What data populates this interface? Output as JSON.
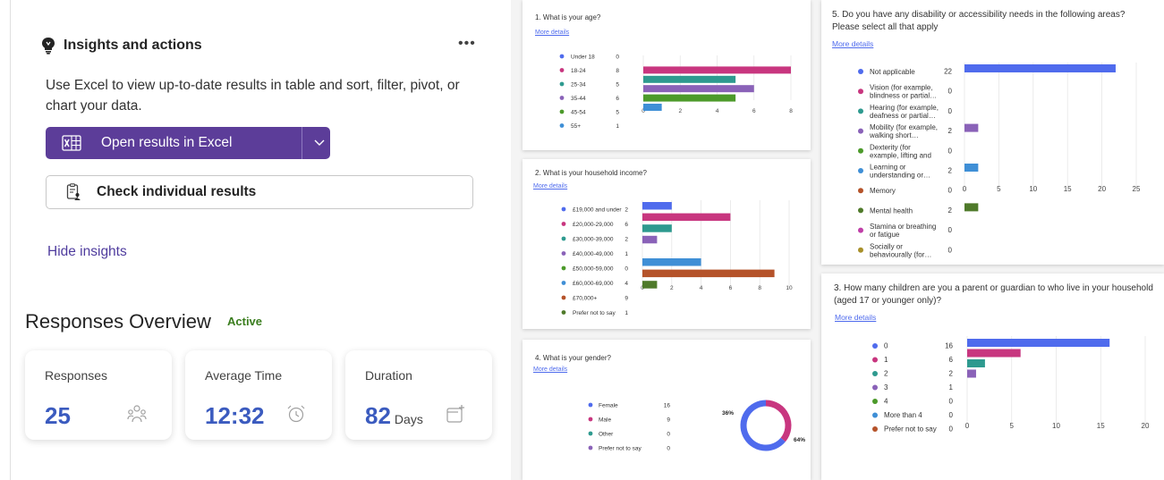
{
  "insights": {
    "title": "Insights and actions",
    "more": "•••",
    "description": "Use Excel to view up-to-date results in table and sort, filter, pivot, or chart your data.",
    "excel_button": "Open results in Excel",
    "check_button": "Check individual results",
    "hide_link": "Hide insights"
  },
  "overview": {
    "title": "Responses Overview",
    "status": "Active",
    "cards": [
      {
        "title": "Responses",
        "value": "25",
        "unit": ""
      },
      {
        "title": "Average Time",
        "value": "12:32",
        "unit": ""
      },
      {
        "title": "Duration",
        "value": "82",
        "unit": "Days"
      }
    ]
  },
  "more_details": "More details",
  "colors": {
    "purple": "#5c3d99",
    "blue": "#3b5bbf",
    "green": "#3a7d1e"
  },
  "chart_data": [
    {
      "type": "bar",
      "title": "1. What is your age?",
      "categories": [
        "Under 18",
        "18-24",
        "25-34",
        "35-44",
        "45-54",
        "55+"
      ],
      "values": [
        0,
        8,
        5,
        6,
        5,
        1
      ],
      "colors": [
        "#4f6bed",
        "#c8367f",
        "#2e9a8f",
        "#8a62b8",
        "#4c9a2a",
        "#3f8fd6"
      ],
      "xlim": [
        0,
        8
      ],
      "ticks": [
        0,
        2,
        4,
        6,
        8
      ]
    },
    {
      "type": "bar",
      "title": "2. What is your household income?",
      "categories": [
        "£19,000 and under",
        "£20,000-29,000",
        "£30,000-39,000",
        "£40,000-49,000",
        "£50,000-59,000",
        "£60,000-69,000",
        "£70,000+",
        "Prefer not to say"
      ],
      "values": [
        2,
        6,
        2,
        1,
        0,
        4,
        9,
        1
      ],
      "colors": [
        "#4f6bed",
        "#c8367f",
        "#2e9a8f",
        "#8a62b8",
        "#4c9a2a",
        "#3f8fd6",
        "#b5532a",
        "#4f7a2a"
      ],
      "xlim": [
        0,
        10
      ],
      "ticks": [
        0,
        2,
        4,
        6,
        8,
        10
      ]
    },
    {
      "type": "pie",
      "title": "4. What is your gender?",
      "categories": [
        "Female",
        "Male",
        "Other",
        "Prefer not to say"
      ],
      "values": [
        16,
        9,
        0,
        0
      ],
      "colors": [
        "#4f6bed",
        "#c8367f",
        "#2e9a8f",
        "#8a62b8"
      ],
      "labels": [
        "64%",
        "36%"
      ]
    },
    {
      "type": "bar",
      "title": "5. Do you have any disability or accessibility needs in the following areas? Please select all that apply",
      "categories": [
        "Not applicable",
        "Vision (for example, blindness or partial…",
        "Hearing (for example, deafness or partial…",
        "Mobility (for example, walking short…",
        "Dexterity (for example, lifting and carrying…",
        "Learning or understanding or…",
        "Memory",
        "Mental health",
        "Stamina or breathing or fatigue",
        "Socially or behaviourally (for…"
      ],
      "values": [
        22,
        0,
        0,
        2,
        0,
        2,
        0,
        2,
        0,
        0
      ],
      "colors": [
        "#4f6bed",
        "#c8367f",
        "#2e9a8f",
        "#8a62b8",
        "#4c9a2a",
        "#3f8fd6",
        "#b5532a",
        "#4f7a2a",
        "#c03fa8",
        "#a8902a"
      ],
      "xlim": [
        0,
        25
      ],
      "ticks": [
        0,
        5,
        10,
        15,
        20,
        25
      ]
    },
    {
      "type": "bar",
      "title": "3. How many children are you a parent or guardian to who live in your household (aged 17 or younger only)?",
      "categories": [
        "0",
        "1",
        "2",
        "3",
        "4",
        "More than 4",
        "Prefer not to say"
      ],
      "values": [
        16,
        6,
        2,
        1,
        0,
        0,
        0
      ],
      "colors": [
        "#4f6bed",
        "#c8367f",
        "#2e9a8f",
        "#8a62b8",
        "#4c9a2a",
        "#3f8fd6",
        "#b5532a"
      ],
      "xlim": [
        0,
        20
      ],
      "ticks": [
        0,
        5,
        10,
        15,
        20
      ]
    }
  ]
}
